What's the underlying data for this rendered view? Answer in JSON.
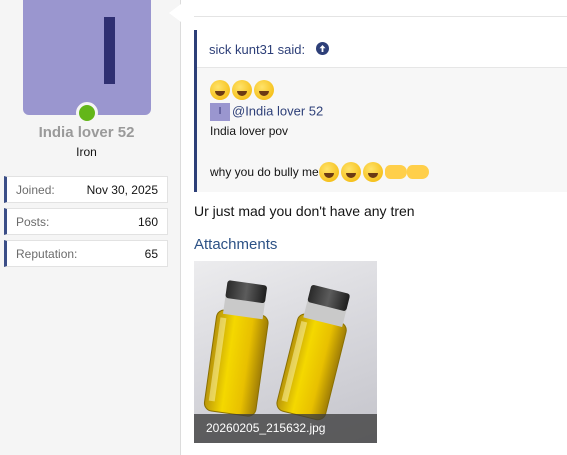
{
  "user": {
    "name": "India lover 52",
    "title": "Iron",
    "avatar_letter": "I",
    "online": true,
    "stats": [
      {
        "label": "Joined:",
        "value": "Nov 30, 2025"
      },
      {
        "label": "Posts:",
        "value": "160"
      },
      {
        "label": "Reputation:",
        "value": "65"
      }
    ]
  },
  "post": {
    "quote": {
      "author_label": "sick kunt31 said:",
      "mention_avatar_letter": "I",
      "mention": "@India lover 52",
      "line1": "India lover pov",
      "line2": "why you do bully me",
      "emojis_top": [
        "rofl",
        "rofl",
        "rofl"
      ],
      "emojis_inline": [
        "rofl",
        "rofl",
        "rofl",
        "hand-pointing-left",
        "hand-pointing-left"
      ]
    },
    "body": "Ur just mad you don't have any tren",
    "attachments_title": "Attachments",
    "attachment": {
      "filename": "20260205_215632.jpg"
    }
  },
  "colors": {
    "accent": "#2d3f78",
    "link": "#2d5286",
    "avatar_bg": "#9a96cf",
    "online": "#63b619"
  }
}
